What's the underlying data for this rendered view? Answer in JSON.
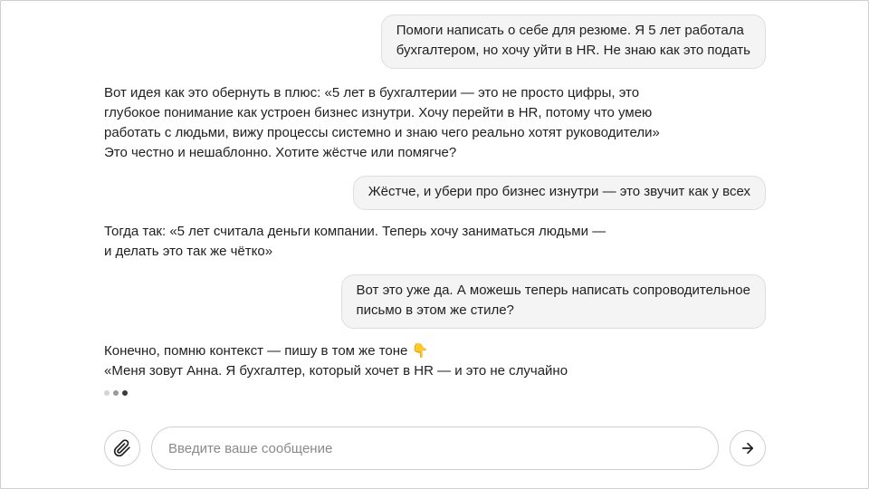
{
  "messages": [
    {
      "role": "user",
      "lines": [
        "Помоги написать о себе для резюме. Я 5 лет работала",
        "бухгалтером, но хочу уйти в HR. Не знаю как это подать"
      ]
    },
    {
      "role": "assistant",
      "lines": [
        "Вот идея как это обернуть в плюс: «5 лет в бухгалтерии — это не просто цифры, это",
        "глубокое понимание как устроен бизнес изнутри. Хочу перейти в HR, потому что умею",
        "работать с людьми, вижу процессы системно и знаю чего реально хотят руководители»",
        "Это честно и нешаблонно. Хотите жёстче или помягче?"
      ]
    },
    {
      "role": "user",
      "lines": [
        "Жёстче, и убери про бизнес изнутри — это звучит как у всех"
      ]
    },
    {
      "role": "assistant",
      "lines": [
        "Тогда так: «5 лет считала деньги компании. Теперь хочу заниматься людьми —",
        "и делать это так же чётко»"
      ]
    },
    {
      "role": "user",
      "lines": [
        "Вот это уже да. А можешь теперь написать сопроводительное",
        "письмо в этом же стиле?"
      ]
    },
    {
      "role": "assistant",
      "lines": [
        "Конечно, помню контекст — пишу в том же тоне 👇",
        "«Меня зовут Анна. Я бухгалтер, который хочет в HR — и это не случайно"
      ]
    }
  ],
  "composer": {
    "placeholder": "Введите ваше сообщение",
    "attach_icon": "paperclip-icon",
    "send_icon": "arrow-right-icon"
  },
  "typing_indicator": {
    "dots": 3
  }
}
